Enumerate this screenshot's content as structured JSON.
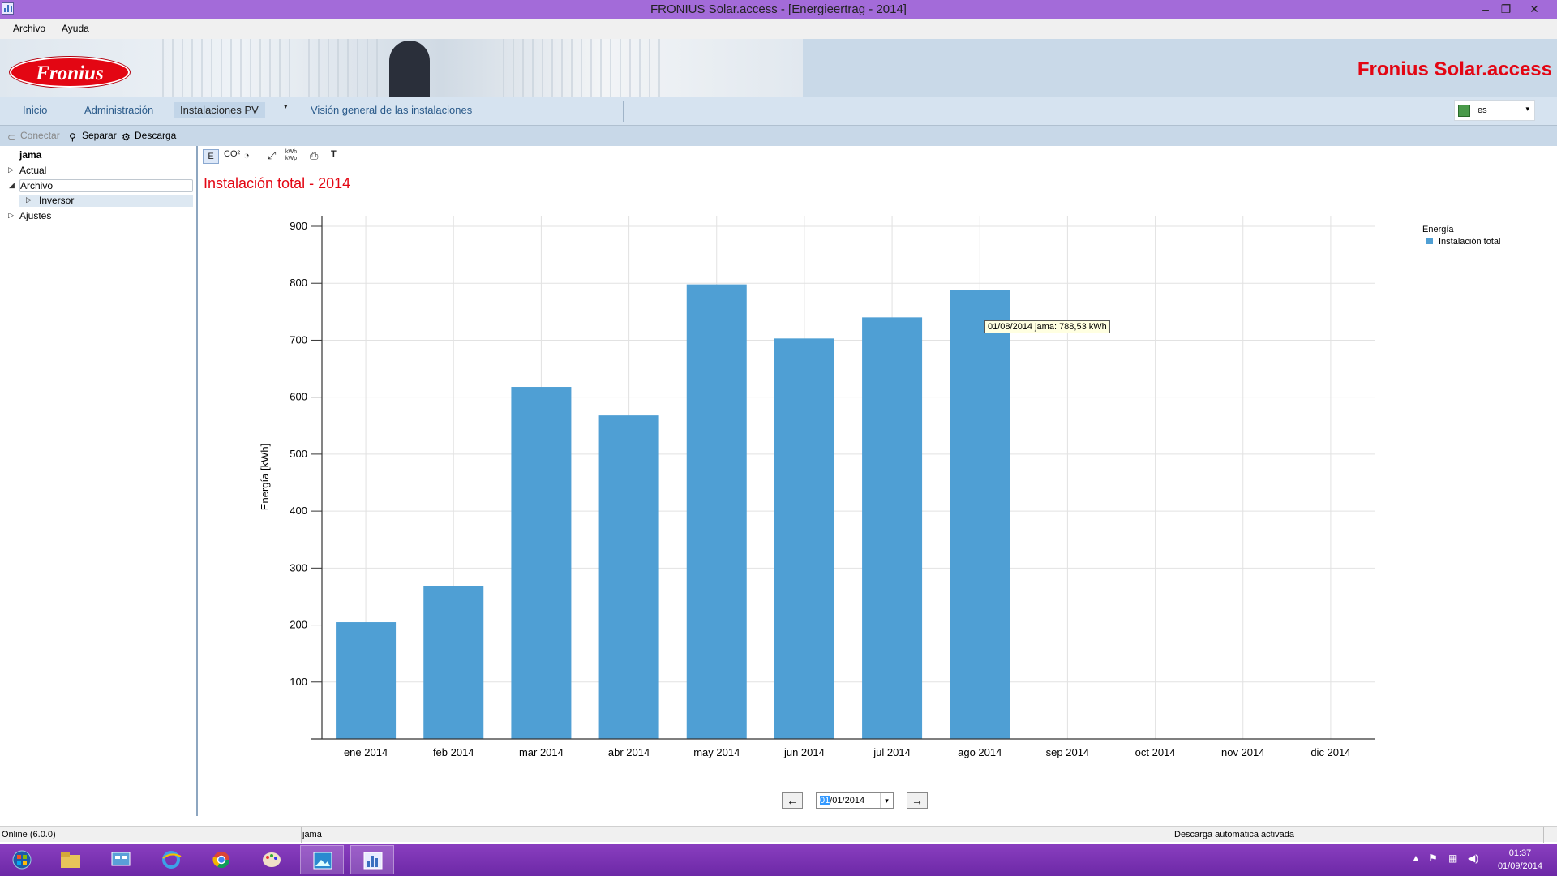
{
  "window": {
    "title": "FRONIUS Solar.access - [Energieertrag - 2014]",
    "controls": {
      "minimize": "–",
      "restore": "❐",
      "close": "✕"
    }
  },
  "menu": {
    "items": [
      "Archivo",
      "Ayuda"
    ]
  },
  "banner": {
    "logo_text": "Fronius",
    "brand": "Fronius Solar.access"
  },
  "nav": {
    "tabs": [
      "Inicio",
      "Administración",
      "Instalaciones PV",
      "Visión general de las instalaciones"
    ],
    "active_tab": "Instalaciones PV",
    "language": "es"
  },
  "toolbar": {
    "connect": "Conectar",
    "separate": "Separar",
    "download": "Descarga"
  },
  "tree": {
    "root": "jama",
    "items": [
      {
        "label": "Actual",
        "state": "collapsed"
      },
      {
        "label": "Archivo",
        "state": "expanded"
      },
      {
        "label": "Inversor",
        "state": "collapsed"
      },
      {
        "label": "Ajustes",
        "state": "collapsed"
      }
    ]
  },
  "chart_tools": {
    "energy": "E",
    "co2": "CO²",
    "kwp": "kWh kWp",
    "text": "T"
  },
  "tooltip": {
    "text": "01/08/2014 jama: 788,53 kWh"
  },
  "date_nav": {
    "prefix": "01",
    "rest": "/01/2014"
  },
  "chart_data": {
    "type": "bar",
    "title": "Instalación total - 2014",
    "ylabel": "Energía [kWh]",
    "xlabel": "",
    "categories": [
      "ene 2014",
      "feb 2014",
      "mar 2014",
      "abr 2014",
      "may 2014",
      "jun 2014",
      "jul 2014",
      "ago 2014",
      "sep 2014",
      "oct 2014",
      "nov 2014",
      "dic 2014"
    ],
    "series": [
      {
        "name": "Instalación total",
        "values": [
          205,
          268,
          618,
          568,
          798,
          703,
          740,
          788.53,
          null,
          null,
          null,
          null
        ],
        "color": "#4f9fd4"
      }
    ],
    "ylim": [
      0,
      900
    ],
    "yticks": [
      100,
      200,
      300,
      400,
      500,
      600,
      700,
      800,
      900
    ],
    "grid": true,
    "legend": {
      "title": "Energía",
      "placement": "top-right"
    }
  },
  "status": {
    "left": "Online (6.0.0)",
    "middle": "jama",
    "right": "Descarga automática activada"
  },
  "taskbar": {
    "time": "01:37",
    "date": "01/09/2014"
  }
}
